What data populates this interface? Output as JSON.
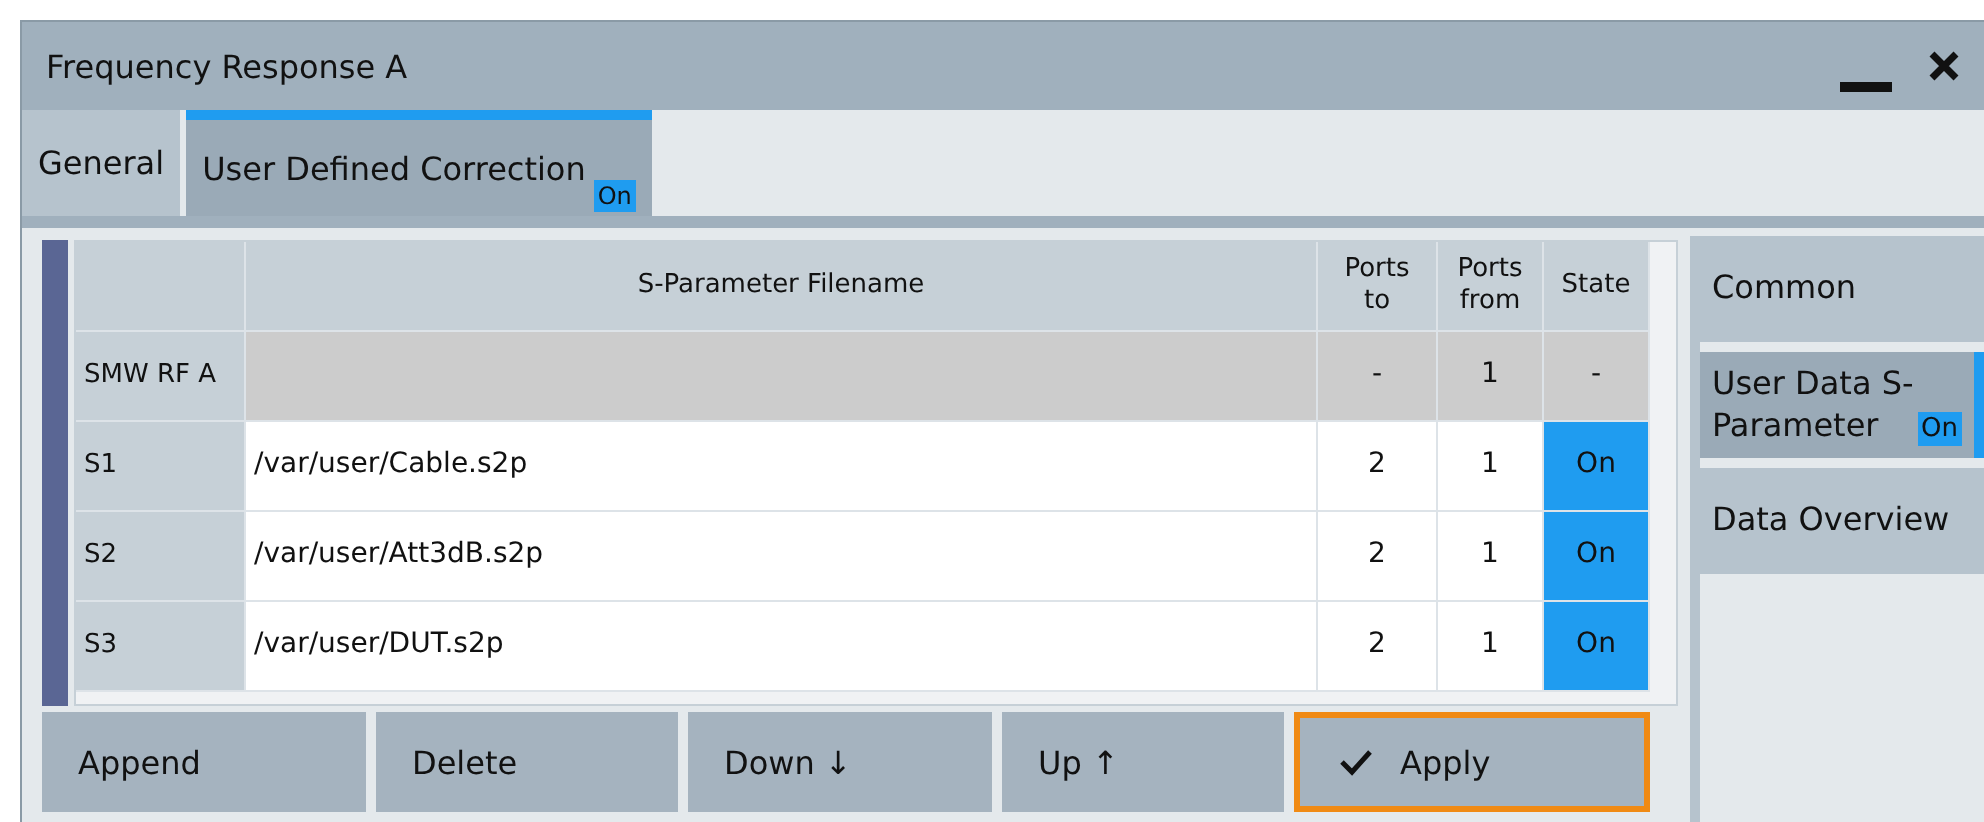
{
  "window": {
    "title": "Frequency Response A"
  },
  "tabs": [
    {
      "label": "General",
      "selected": false
    },
    {
      "label": "User Defined Correction",
      "selected": true,
      "badge": "On"
    }
  ],
  "table": {
    "columns": [
      "S-Parameter Filename",
      "Ports to",
      "Ports from",
      "State"
    ],
    "rows": [
      {
        "kind": "reference",
        "name": "SMW RF A",
        "filename": "",
        "ports_to": "-",
        "ports_from": "1",
        "state": "-",
        "on": false
      },
      {
        "kind": "file",
        "name": "S1",
        "filename": "/var/user/Cable.s2p",
        "ports_to": "2",
        "ports_from": "1",
        "state": "On",
        "on": true
      },
      {
        "kind": "file",
        "name": "S2",
        "filename": "/var/user/Att3dB.s2p",
        "ports_to": "2",
        "ports_from": "1",
        "state": "On",
        "on": true
      },
      {
        "kind": "file",
        "name": "S3",
        "filename": "/var/user/DUT.s2p",
        "ports_to": "2",
        "ports_from": "1",
        "state": "On",
        "on": true
      }
    ]
  },
  "buttons": [
    {
      "label": "Append",
      "kind": "plain"
    },
    {
      "label": "Delete",
      "kind": "plain"
    },
    {
      "label": "Down ↓",
      "kind": "plain"
    },
    {
      "label": "Up ↑",
      "kind": "plain"
    },
    {
      "label": "Apply",
      "kind": "apply"
    }
  ],
  "sidebar": {
    "items": [
      {
        "label": "Common",
        "selected": false
      },
      {
        "label": "User Data S-Parameter",
        "selected": true,
        "badge": "On"
      },
      {
        "label": "Data Overview",
        "selected": false
      }
    ]
  }
}
